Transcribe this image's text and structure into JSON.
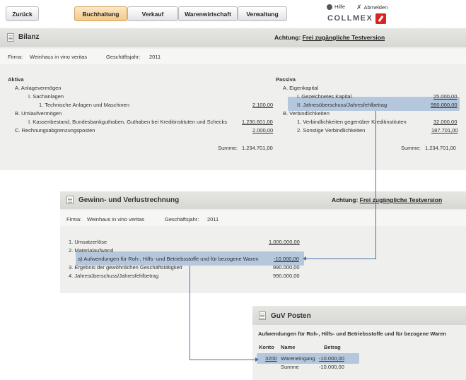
{
  "toolbar": {
    "back_label": "Zurück",
    "tabs": [
      {
        "label": "Buchhaltung",
        "active": true
      },
      {
        "label": "Verkauf",
        "active": false
      },
      {
        "label": "Warenwirtschaft",
        "active": false
      },
      {
        "label": "Verwaltung",
        "active": false
      }
    ],
    "help_label": "Hilfe",
    "logout_label": "Abmelden",
    "brand": "COLLMEX",
    "active_color": "#f3c98a"
  },
  "bilanz": {
    "title": "Bilanz",
    "warning_prefix": "Achtung:",
    "warning_link": "Frei zugängliche Testversion",
    "firma_label": "Firma:",
    "firma_value": "Weinhaus in vino veritas",
    "gj_label": "Geschäftsjahr:",
    "gj_value": "2011",
    "aktiva": {
      "heading": "Aktiva",
      "a": "A.  Anlagevermögen",
      "a1": "I.  Sachanlagen",
      "a11": "1.  Technische Anlagen und Maschinen",
      "a11_value": "2.100,00",
      "b": "B.  Umlaufvermögen",
      "b1": "I.  Kassenbestand, Bundesbankguthaben, Guthaben bei Kreditinstituten und Schecks",
      "b1_value": "1.230.601,00",
      "c": "C.  Rechnungsabgrenzungsposten",
      "c_value": "2.000,00",
      "sum_label": "Summe:",
      "sum_value": "1.234.701,00"
    },
    "passiva": {
      "heading": "Passiva",
      "a": "A.  Eigenkapital",
      "a1": "I.  Gezeichnetes Kapital",
      "a1_value": "25.000,00",
      "a2": "II.  Jahresüberschuss/Jahresfehlbetrag",
      "a2_value": "990.000,00",
      "b": "B.  Verbindlichkeiten",
      "b1": "1.  Verbindlichkeiten gegenüber Kreditinstituten",
      "b1_value": "32.000,00",
      "b2": "2.  Sonstige Verbindlichkeiten",
      "b2_value": "187.701,00",
      "sum_label": "Summe:",
      "sum_value": "1.234.701,00"
    }
  },
  "guv": {
    "title": "Gewinn- und Verlustrechnung",
    "warning_prefix": "Achtung:",
    "warning_link": "Frei zugängliche Testversion",
    "firma_label": "Firma:",
    "firma_value": "Weinhaus in vino veritas",
    "gj_label": "Geschäftsjahr:",
    "gj_value": "2011",
    "rows": {
      "r1": "1.  Umsatzerlöse",
      "r1_value": "1.000.000,00",
      "r2": "2.  Materialaufwand",
      "r2a": "a)  Aufwendungen für Roh-, Hilfs- und Betriebsstoffe und für bezogene Waren",
      "r2a_value": "-10.000,00",
      "r3": "3.  Ergebnis der gewöhnlichen Geschäftstätigkeit",
      "r3_value": "990.000,00",
      "r4": "4.  Jahresüberschuss/Jahresfehlbetrag",
      "r4_value": "990.000,00"
    }
  },
  "posten": {
    "title": "GuV Posten",
    "subtitle": "Aufwendungen für Roh-, Hilfs- und Betriebsstoffe und für bezogene Waren",
    "col_konto": "Konto",
    "col_name": "Name",
    "col_betrag": "Betrag",
    "row_konto": "3200",
    "row_name": "Wareneingang",
    "row_betrag": "-10.000,00",
    "sum_label": "Summe",
    "sum_value": "-10.000,00"
  },
  "highlight_color": "#a9bfd9",
  "connector_color": "#4a6fa8"
}
